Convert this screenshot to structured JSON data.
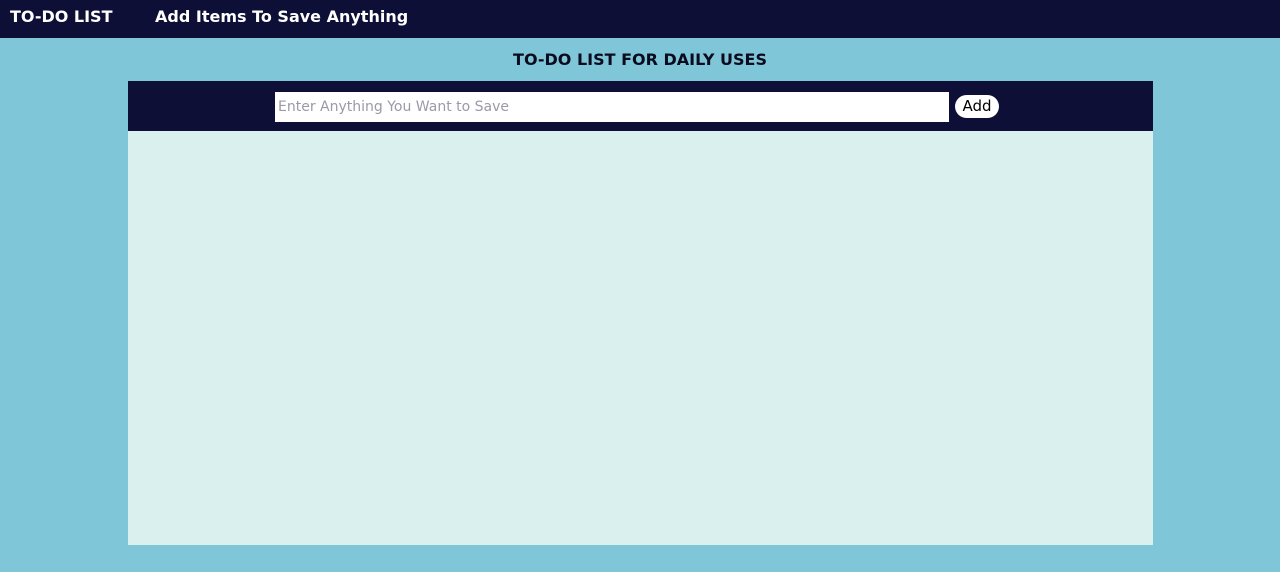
{
  "navbar": {
    "brand": "TO-DO LIST",
    "tagline": "Add Items To Save Anything"
  },
  "main": {
    "heading": "TO-DO LIST FOR DAILY USES",
    "input": {
      "placeholder": "Enter Anything You Want to Save",
      "value": ""
    },
    "add_label": "Add",
    "items": []
  },
  "colors": {
    "navbar_bg": "#0e0f36",
    "page_bg": "#7fc6d8",
    "list_bg": "#daf0ee"
  }
}
